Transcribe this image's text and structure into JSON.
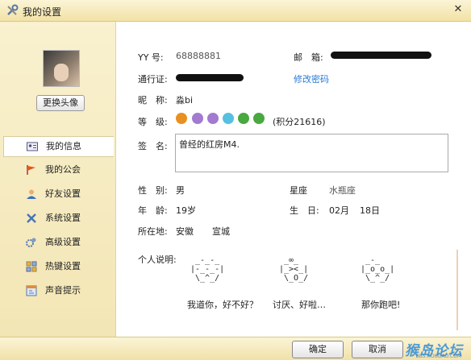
{
  "window": {
    "title": "我的设置",
    "close_glyph": "✕"
  },
  "sidebar": {
    "change_avatar_label": "更换头像",
    "items": [
      {
        "label": "我的信息",
        "icon": "profile-card-icon",
        "active": true
      },
      {
        "label": "我的公会",
        "icon": "flag-icon"
      },
      {
        "label": "好友设置",
        "icon": "user-icon"
      },
      {
        "label": "系统设置",
        "icon": "tools-icon"
      },
      {
        "label": "高级设置",
        "icon": "gear-user-icon"
      },
      {
        "label": "热键设置",
        "icon": "hotkey-icon"
      },
      {
        "label": "声音提示",
        "icon": "sound-icon"
      }
    ]
  },
  "profile": {
    "yy_label": "YY 号:",
    "yy_value": "68888881",
    "email_label": "邮　箱:",
    "passport_label": "通行证:",
    "change_password_link": "修改密码",
    "nickname_label": "昵　称:",
    "nickname_value": "淼bi",
    "level_label": "等　级:",
    "level_points": "(积分21616)",
    "signature_label": "签　名:",
    "signature_value": "曾经的红房M4.",
    "gender_label": "性　别:",
    "gender_value": "男",
    "constellation_label": "星座",
    "constellation_value": "水瓶座",
    "age_label": "年　龄:",
    "age_value": "19岁",
    "birthday_label": "生　日:",
    "birthday_month": "02月",
    "birthday_day": "18日",
    "location_label": "所在地:",
    "location_province": "安徽",
    "location_city": "宣城",
    "personal_label": "个人说明:"
  },
  "description_images": [
    {
      "art": " _-_-_\n|-_-_-|\n \\_^_/",
      "caption": "我道你，好不好？"
    },
    {
      "art": " _∞_\n|_><_|\n \\_O_/",
      "caption": "讨厌、好啦…"
    },
    {
      "art": " _-_\n|_o_o_|\n \\_^_/",
      "caption": "那你跑吧!"
    }
  ],
  "footer": {
    "ok_label": "确定",
    "cancel_label": "取消",
    "watermark": "猴岛论坛",
    "watermark_url": "BBS.HOUDAO.COM"
  },
  "colors": {
    "link": "#2a7ad5",
    "titlebar": "#f2e2a6",
    "sidebar": "#f6ebc2"
  }
}
